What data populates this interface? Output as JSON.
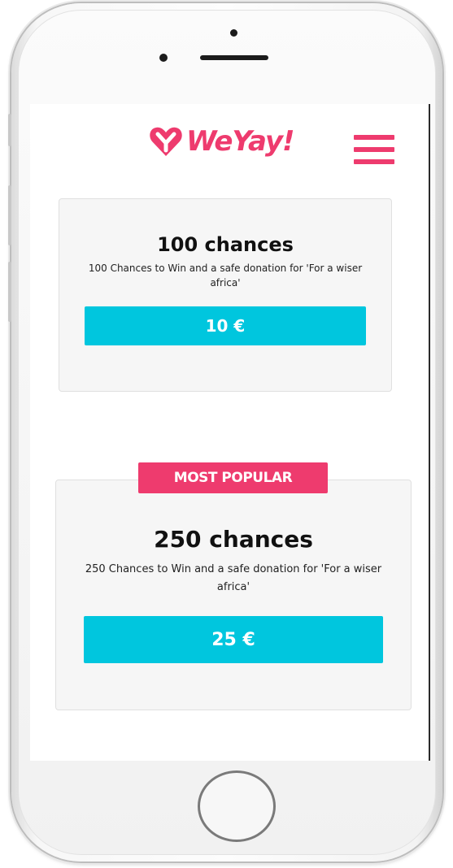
{
  "header": {
    "logo_text": "WeYay!",
    "menu_icon": "hamburger-menu-icon"
  },
  "colors": {
    "brand": "#ee3b6e",
    "button": "#00c6de",
    "card_bg": "#f6f6f6"
  },
  "packages": [
    {
      "title": "100 chances",
      "description": "100 Chances to Win and a safe donation for 'For a wiser africa'",
      "price": "10  €",
      "badge": ""
    },
    {
      "title": "250 chances",
      "description": "250 Chances to Win and a safe donation for 'For a wiser africa'",
      "price": "25  €",
      "badge": "MOST POPULAR"
    }
  ]
}
